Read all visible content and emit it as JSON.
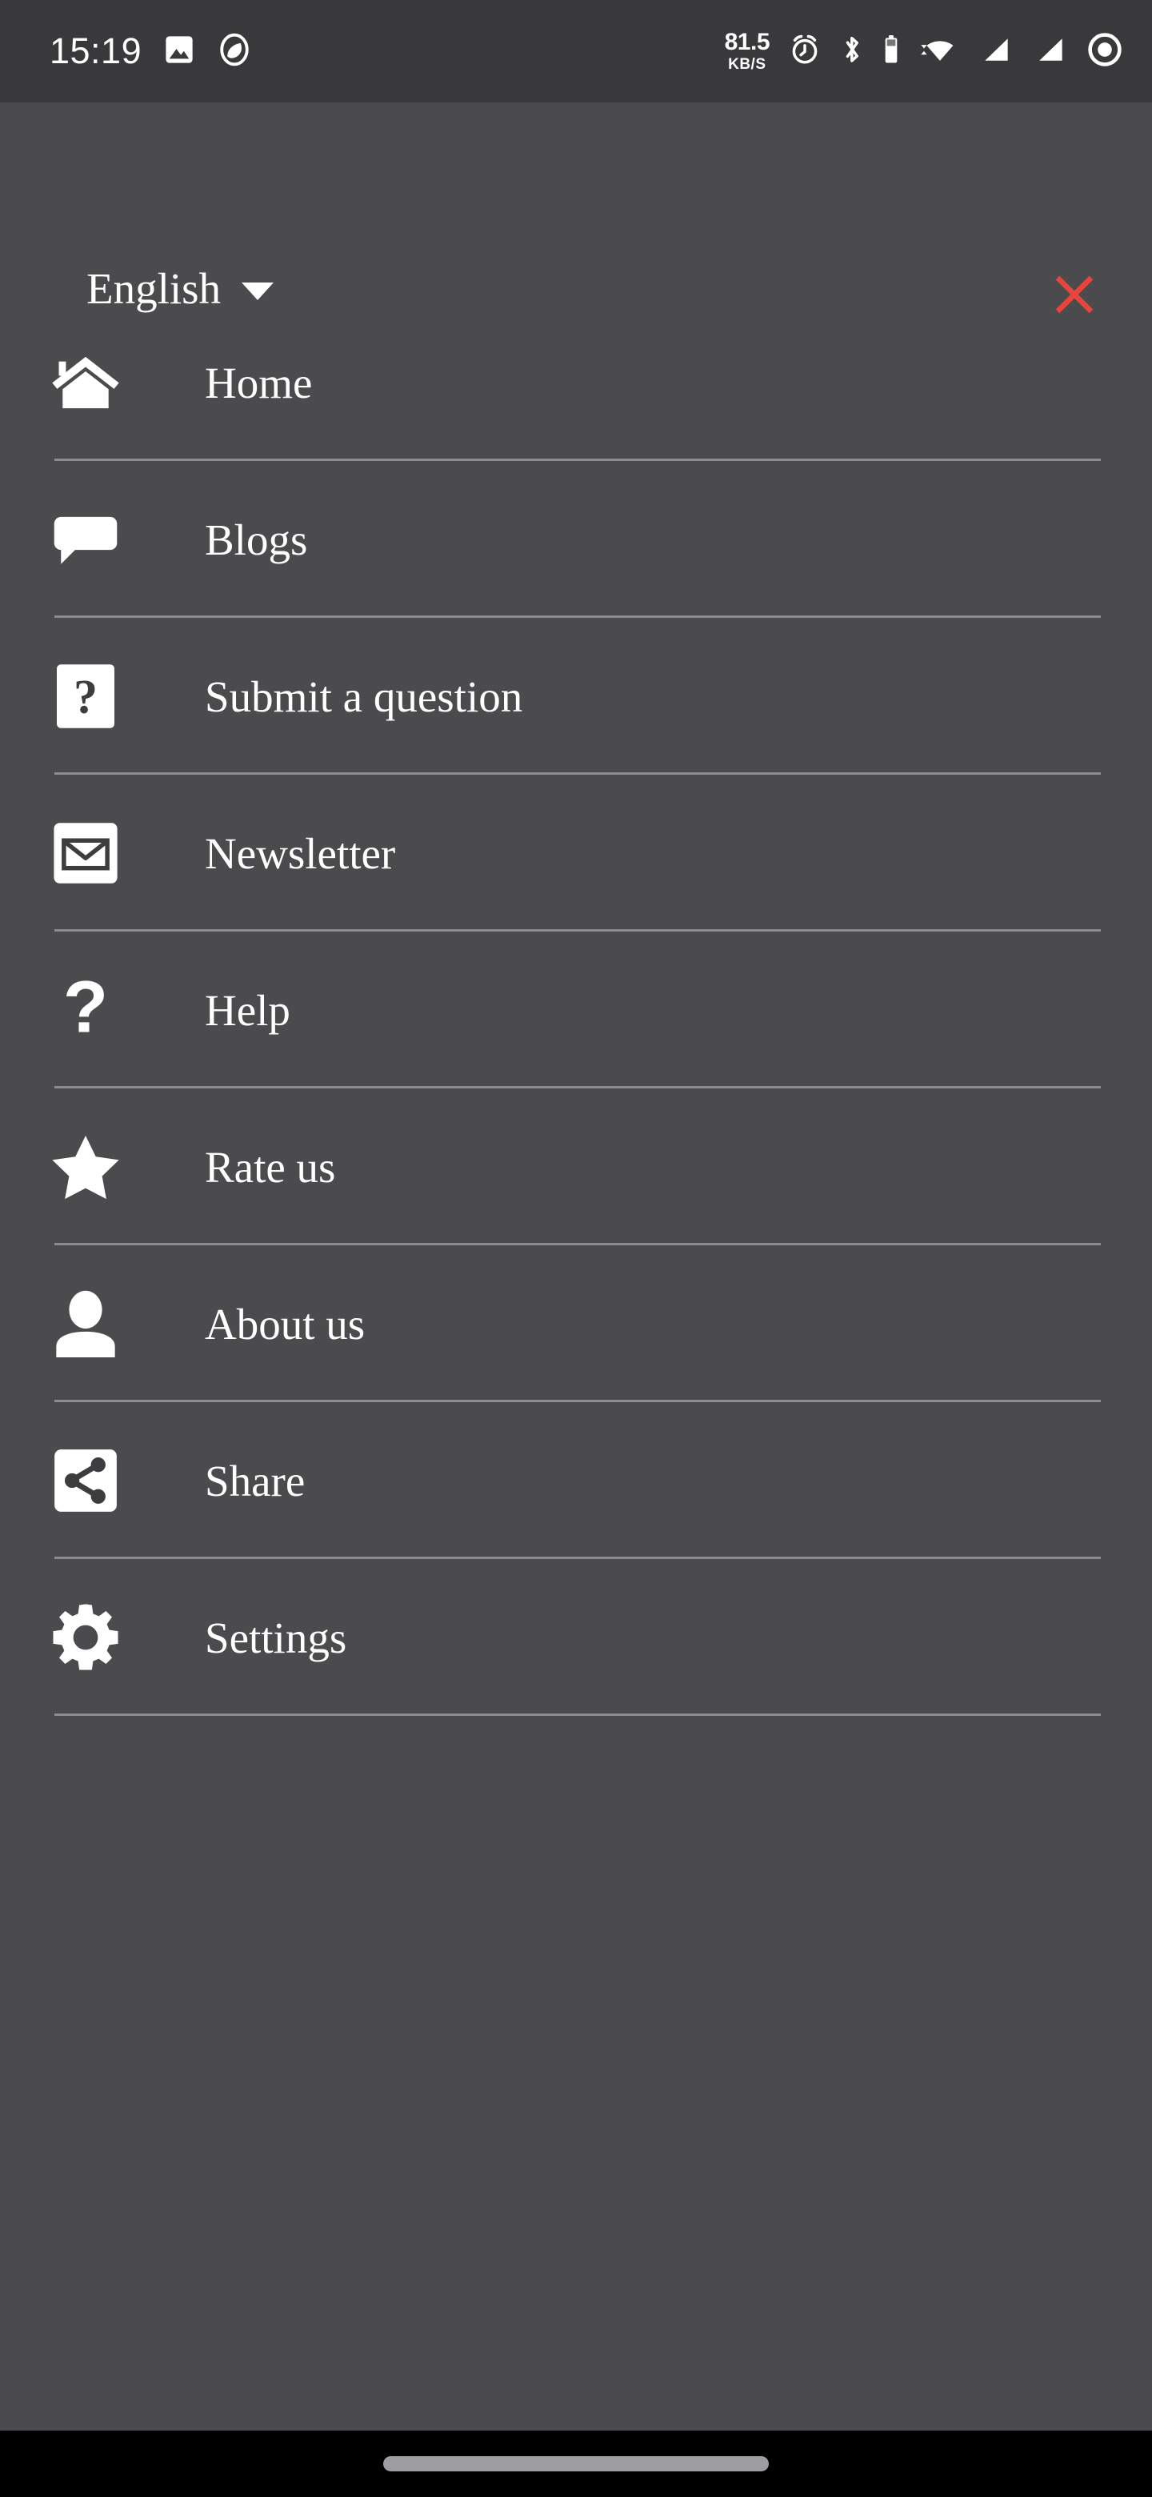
{
  "status_bar": {
    "clock": "15:19",
    "icons_left": [
      "image-icon",
      "do-not-disturb-icon"
    ],
    "network_speed_value": "81.5",
    "network_speed_unit": "KB/S",
    "icons_right": [
      "alarm-icon",
      "bluetooth-icon",
      "battery-icon",
      "wifi-icon",
      "signal-sim1-icon",
      "signal-sim2-icon",
      "record-icon"
    ]
  },
  "header": {
    "language_label": "English",
    "language_caret_icon": "chevron-down-icon",
    "close_icon": "close-x-icon",
    "close_color": "#e8453c"
  },
  "menu": {
    "items": [
      {
        "label": "Home",
        "icon": "home-icon"
      },
      {
        "label": "Blogs",
        "icon": "chat-bubble-icon"
      },
      {
        "label": "Submit a question",
        "icon": "question-box-icon"
      },
      {
        "label": "Newsletter",
        "icon": "envelope-box-icon"
      },
      {
        "label": "Help",
        "icon": "question-mark-icon"
      },
      {
        "label": "Rate us",
        "icon": "star-icon"
      },
      {
        "label": "About us",
        "icon": "person-icon"
      },
      {
        "label": "Share",
        "icon": "share-box-icon"
      },
      {
        "label": "Settings",
        "icon": "gear-icon"
      }
    ]
  },
  "nav_bar": {
    "home_indicator": "home-indicator-pill"
  },
  "colors": {
    "status_bar_bg": "#39383a",
    "drawer_bg": "#4b4a4c",
    "divider": "#8d8c8e",
    "text": "#ffffff",
    "accent_close": "#e8453c",
    "nav_bg": "#000000"
  }
}
